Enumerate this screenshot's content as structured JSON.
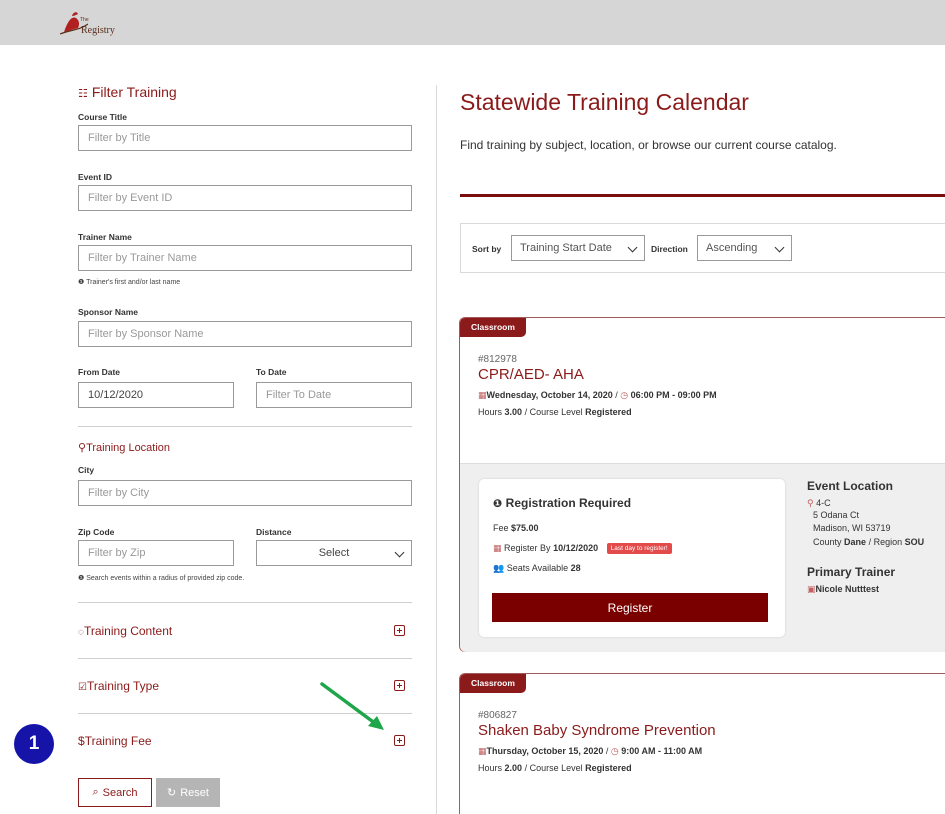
{
  "header": {
    "logo_small": "The",
    "logo_text": "Registry"
  },
  "filter": {
    "title": "Filter Training",
    "course_title_label": "Course Title",
    "course_title_placeholder": "Filter by Title",
    "event_id_label": "Event ID",
    "event_id_placeholder": "Filter by Event ID",
    "trainer_name_label": "Trainer Name",
    "trainer_name_placeholder": "Filter by Trainer Name",
    "trainer_hint": "Trainer's first and/or last name",
    "sponsor_name_label": "Sponsor Name",
    "sponsor_name_placeholder": "Filter by Sponsor Name",
    "from_date_label": "From Date",
    "from_date_value": "10/12/2020",
    "to_date_label": "To Date",
    "to_date_placeholder": "Filter To Date",
    "location_title": "Training Location",
    "city_label": "City",
    "city_placeholder": "Filter by City",
    "zip_label": "Zip Code",
    "zip_placeholder": "Filter by Zip",
    "distance_label": "Distance",
    "distance_value": "Select",
    "radius_hint": "Search events within a radius of provided zip code.",
    "content_title": "Training Content",
    "type_title": "Training Type",
    "fee_title": "Training Fee",
    "search_label": "Search",
    "reset_label": "Reset"
  },
  "main": {
    "title": "Statewide Training Calendar",
    "subtitle": "Find training by subject, location, or browse our current course catalog.",
    "sort_by_label": "Sort by",
    "sort_by_value": "Training Start Date",
    "direction_label": "Direction",
    "direction_value": "Ascending"
  },
  "cards": [
    {
      "tag": "Classroom",
      "id": "#812978",
      "title": "CPR/AED- AHA",
      "date": "Wednesday, October 14, 2020",
      "time": "06:00 PM - 09:00 PM",
      "hours_label": "Hours",
      "hours": "3.00",
      "level_label": "Course Level",
      "level": "Registered",
      "reg_title": "Registration Required",
      "fee_label": "Fee",
      "fee": "$75.00",
      "register_by_label": "Register By",
      "register_by": "10/12/2020",
      "last_day_badge": "Last day to register!",
      "seats_label": "Seats Available",
      "seats": "28",
      "register_button": "Register",
      "location_heading": "Event Location",
      "location_name": "4-C",
      "address1": "5 Odana Ct",
      "address2": "Madison, WI 53719",
      "county_label": "County",
      "county": "Dane",
      "region_label": "Region",
      "region": "SOU",
      "trainer_heading": "Primary Trainer",
      "trainer": "Nicole Nutttest"
    },
    {
      "tag": "Classroom",
      "id": "#806827",
      "title": "Shaken Baby Syndrome Prevention",
      "date": "Thursday, October 15, 2020",
      "time": "9:00 AM - 11:00 AM",
      "hours_label": "Hours",
      "hours": "2.00",
      "level_label": "Course Level",
      "level": "Registered"
    }
  ],
  "annotation": {
    "step_number": "1"
  },
  "colors": {
    "brand": "#8b1a1a",
    "register_button": "#7a0000",
    "annotation_circle": "#1513a8",
    "annotation_arrow": "#1fa64a",
    "last_day_badge": "#e34b4b"
  },
  "icons": [
    "sliders-icon",
    "map-pin-icon",
    "chat-icon",
    "check-square-icon",
    "dollar-icon",
    "plus-square-icon",
    "search-icon",
    "refresh-icon",
    "calendar-icon",
    "clock-icon",
    "info-icon",
    "users-icon",
    "trainer-icon",
    "chevron-down-icon",
    "green-arrow-icon"
  ]
}
